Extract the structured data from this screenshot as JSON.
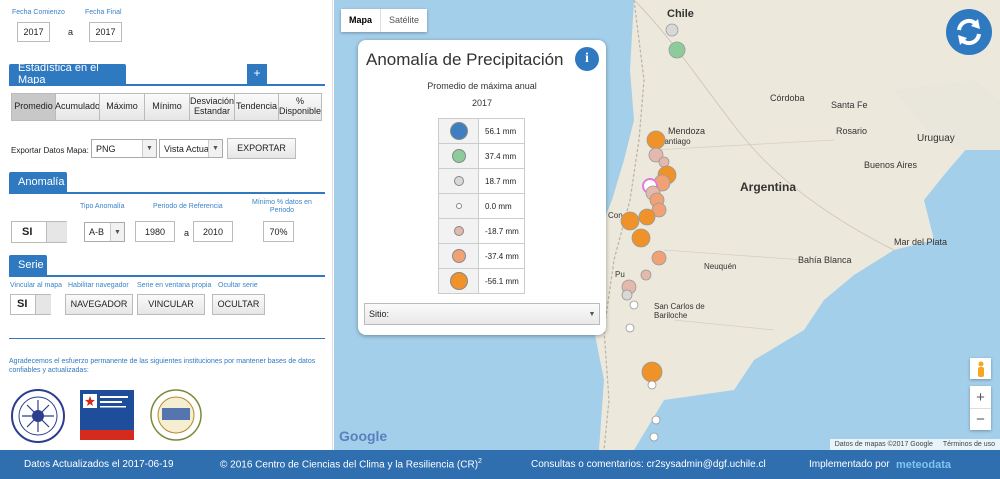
{
  "dates": {
    "start_label": "Fecha Comienzo",
    "end_label": "Fecha Final",
    "start": "2017",
    "sep": "a",
    "end": "2017"
  },
  "stats": {
    "title": "Estadística en el Mapa",
    "add": "+",
    "buttons": [
      "Promedio",
      "Acumulado",
      "Máximo",
      "Mínimo",
      "Desviación Estandar",
      "Tendencia",
      "% Disponible"
    ],
    "export_label": "Exportar Datos Mapa:",
    "format": "PNG",
    "view": "Vista Actual",
    "export_btn": "EXPORTAR"
  },
  "anomaly": {
    "title": "Anomalía",
    "toggle": "SI",
    "type_label": "Tipo Anomalía",
    "type": "A-B",
    "period_label": "Periodo de Referencia",
    "from": "1980",
    "sep": "a",
    "to": "2010",
    "min_label": "Mínimo % datos en Periodo",
    "min": "70%"
  },
  "serie": {
    "title": "Serie",
    "link_label": "Vincular al mapa",
    "nav_label": "Habilitar navegador",
    "win_label": "Serie en ventana propia",
    "hide_label": "Ocultar serie",
    "toggle": "SI",
    "nav_btn": "NAVEGADOR",
    "link_btn": "VINCULAR",
    "hide_btn": "OCULTAR"
  },
  "thanks": "Agradecemos el esfuerzo permanente de las siguientes instituciones por mantener bases de datos confiables y actualizadas:",
  "map": {
    "tabs": [
      "Mapa",
      "Satélite"
    ],
    "active_tab": "Mapa",
    "google": "Google",
    "attribution": "Datos de mapas ©2017 Google",
    "terms": "Términos de uso",
    "zoom_in": "+",
    "zoom_out": "−",
    "places": [
      "Chile",
      "Córdoba",
      "Santa Fe",
      "Mendoza",
      "Rosario",
      "Uruguay",
      "Santiago",
      "Buenos Aires",
      "Argentina",
      "Mar del Plata",
      "Bahía Blanca",
      "Neuquén",
      "San Carlos de Bariloche",
      "Con",
      "Pu"
    ]
  },
  "legend": {
    "title": "Anomalía de Precipitación",
    "info": "i",
    "subtitle": "Promedio de máxima anual",
    "year": "2017",
    "rows": [
      {
        "value": "56.1 mm",
        "color": "#3f7fc0",
        "size": 18
      },
      {
        "value": "37.4 mm",
        "color": "#8ccc9a",
        "size": 14
      },
      {
        "value": "18.7 mm",
        "color": "#d8d8d8",
        "size": 10
      },
      {
        "value": "0.0 mm",
        "color": "#ffffff",
        "size": 6
      },
      {
        "value": "-18.7 mm",
        "color": "#e5b8ad",
        "size": 10
      },
      {
        "value": "-37.4 mm",
        "color": "#f0a276",
        "size": 14
      },
      {
        "value": "-56.1 mm",
        "color": "#f0922a",
        "size": 18
      }
    ],
    "site_label": "Sitio:"
  },
  "footer": {
    "updated": "Datos Actualizados el 2017-06-19",
    "copyright": "© 2016 Centro de Ciencias del Clima y la Resiliencia (CR)",
    "sup": "2",
    "contact": "Consultas o comentarios: cr2sysadmin@dgf.uchile.cl",
    "impl": "Implementado por",
    "brand": "meteodata"
  }
}
